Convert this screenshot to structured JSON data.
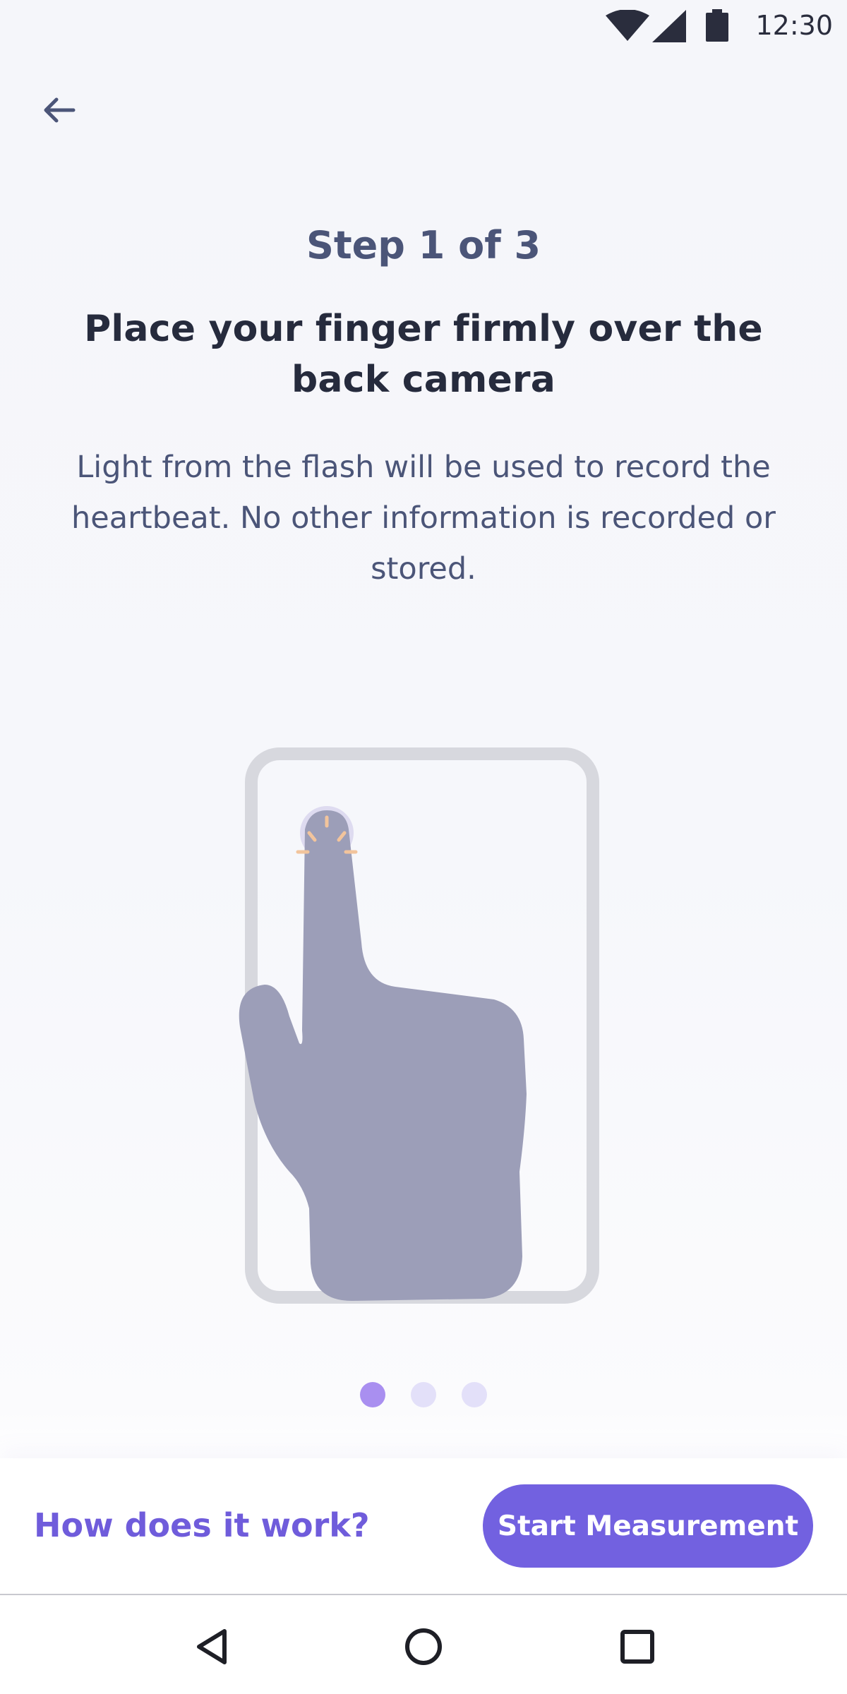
{
  "status_bar": {
    "time": "12:30",
    "icons": [
      "wifi-icon",
      "cell-signal-icon",
      "battery-icon"
    ]
  },
  "header": {
    "back_icon": "arrow-left-icon"
  },
  "content": {
    "step": "Step 1 of 3",
    "title": "Place your finger firmly over the back camera",
    "description": "Light from the flash will be used to record the heartbeat. No other information is recorded or stored."
  },
  "illustration": {
    "icon": "finger-on-phone-camera-illustration"
  },
  "pagination": {
    "total": 3,
    "active_index": 0
  },
  "actions": {
    "secondary_label": "How does it work?",
    "primary_label": "Start Measurement"
  },
  "nav_bar": {
    "icons": [
      "nav-back-icon",
      "nav-home-icon",
      "nav-recent-apps-icon"
    ]
  },
  "colors": {
    "accent": "#7261e0",
    "link": "#6f5cdb",
    "heading": "#262b3d",
    "muted_text": "#4b5578",
    "dot_active": "#a98ff0",
    "dot_inactive": "#e3e0f9",
    "hand": "#9c9eb8",
    "phone_outline": "#d7d8de",
    "flash_rays": "#f2c49c"
  }
}
